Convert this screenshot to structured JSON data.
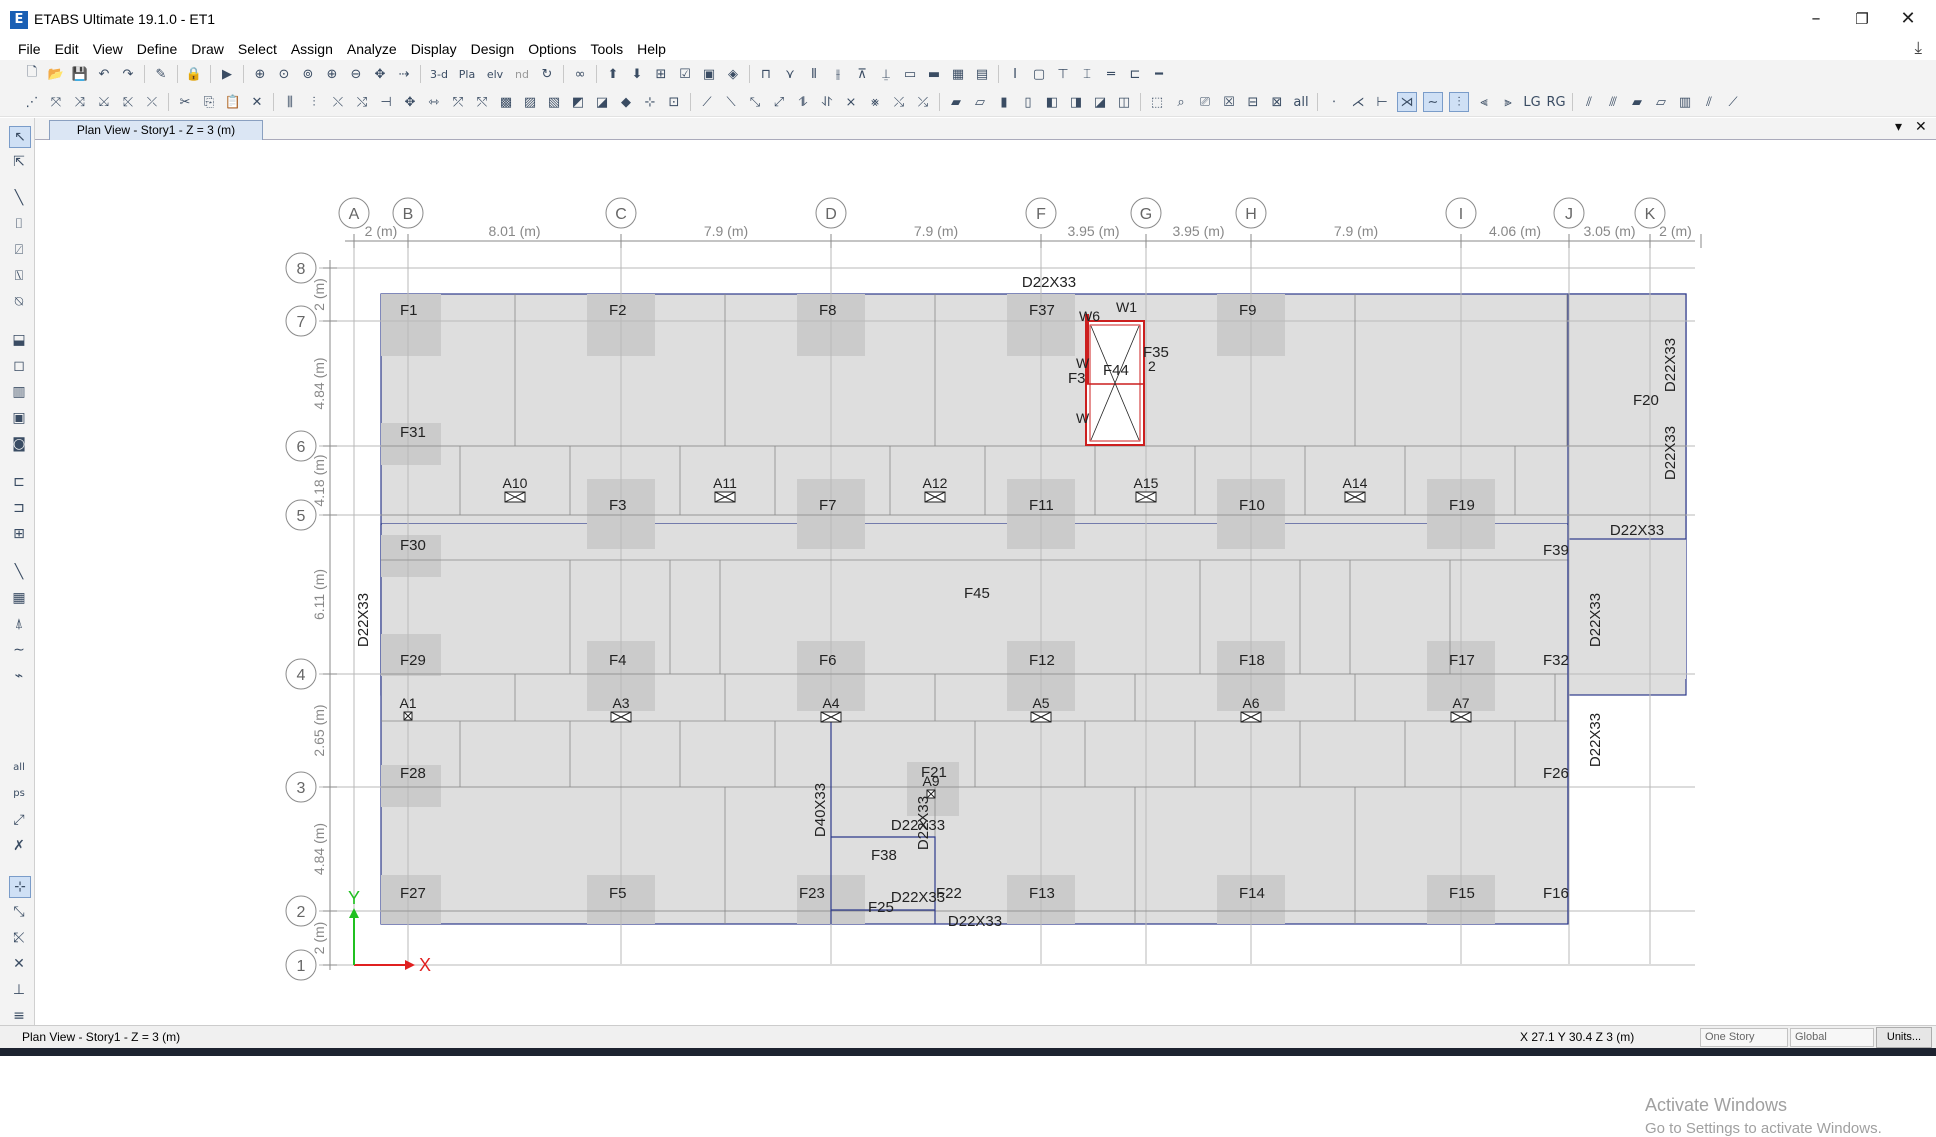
{
  "window": {
    "app_icon_letter": "E",
    "title": "ETABS Ultimate 19.1.0 - ET1",
    "minimize": "–",
    "restore": "❐",
    "close": "✕"
  },
  "menu": [
    "File",
    "Edit",
    "View",
    "Define",
    "Draw",
    "Select",
    "Assign",
    "Analyze",
    "Display",
    "Design",
    "Options",
    "Tools",
    "Help"
  ],
  "tab": {
    "label": "Plan View - Story1 - Z = 3 (m)",
    "dropdown": "▾",
    "close": "✕"
  },
  "toolbar_icons": {
    "view_3d": "3-d",
    "plan": "Pla",
    "elev": "elv",
    "nd": "nd"
  },
  "grid": {
    "x_labels": [
      "A",
      "B",
      "C",
      "D",
      "F",
      "G",
      "H",
      "I",
      "J",
      "K"
    ],
    "y_labels": [
      "1",
      "2",
      "3",
      "4",
      "5",
      "6",
      "7",
      "8"
    ],
    "x_dimensions": [
      "2 (m)",
      "8.01 (m)",
      "7.9 (m)",
      "7.9 (m)",
      "3.95 (m)",
      "3.95 (m)",
      "7.9 (m)",
      "4.06 (m)",
      "3.05 (m)",
      "2 (m)"
    ],
    "y_dimensions": [
      "2 (m)",
      "4.84 (m)",
      "4.18 (m)",
      "6.11 (m)",
      "2.65 (m)",
      "4.84 (m)",
      "2 (m)"
    ]
  },
  "slabs": [
    "F1",
    "F2",
    "F8",
    "F37",
    "F9",
    "F31",
    "F20",
    "F3",
    "F7",
    "F11",
    "F10",
    "F19",
    "F30",
    "F39",
    "F45",
    "F29",
    "F4",
    "F6",
    "F12",
    "F18",
    "F17",
    "F32",
    "F28",
    "F21",
    "F26",
    "F27",
    "F5",
    "F23",
    "F38",
    "F22",
    "F13",
    "F14",
    "F15",
    "F16",
    "F25",
    "F44",
    "F35",
    "F3"
  ],
  "openings": [
    "A10",
    "A11",
    "A12",
    "A15",
    "A14",
    "A1",
    "A3",
    "A4",
    "A5",
    "A6",
    "A7",
    "A9"
  ],
  "beams": [
    "D22X33",
    "D22X33",
    "D22X33",
    "D22X33",
    "D22X33",
    "D22X33",
    "D40X33",
    "D22X33",
    "D22X33",
    "D22X33",
    "D22X33",
    "D22X33"
  ],
  "walls": [
    "W1",
    "W6",
    "W",
    "W",
    "2"
  ],
  "axes": {
    "x": "X",
    "y": "Y"
  },
  "status": {
    "view": "Plan View - Story1 - Z = 3 (m)",
    "coords": "X 27.1  Y 30.4  Z 3 (m)",
    "story_mode": "One Story",
    "coord_system": "Global",
    "units_button": "Units..."
  },
  "watermark": {
    "line1": "Activate Windows",
    "line2": "Go to Settings to activate Windows."
  },
  "colors": {
    "slab_fill": "#dedede",
    "drop_panel": "#cbcbcb",
    "grid_line": "#b9b9b9",
    "beam_outline": "#2d3a8c",
    "wall": "#cc1f1f",
    "axis_x": "#e02020",
    "axis_y": "#20c020"
  }
}
